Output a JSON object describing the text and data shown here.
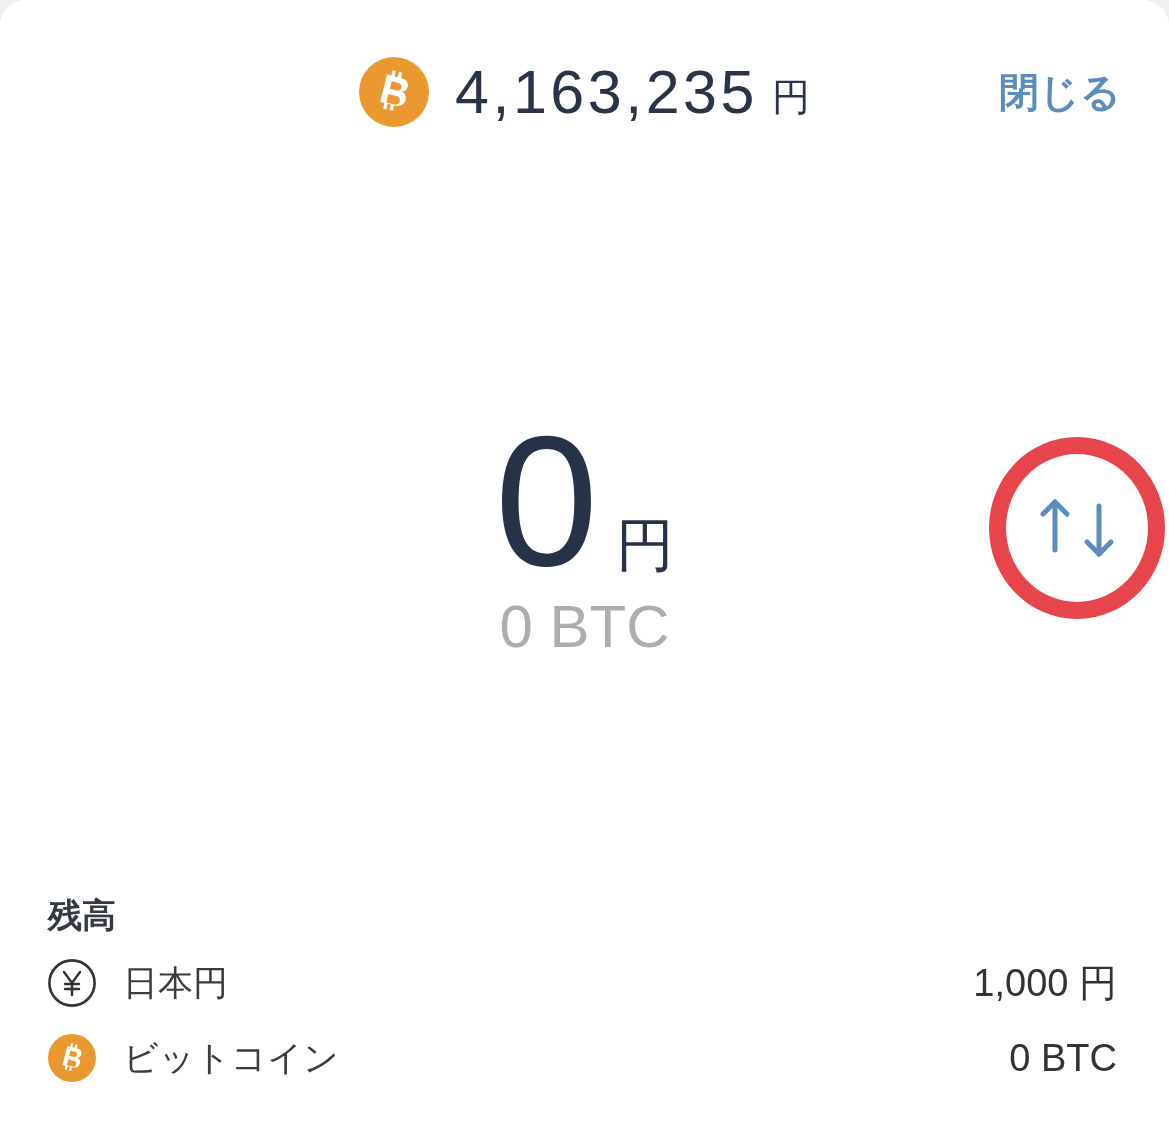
{
  "header": {
    "rate": {
      "amount": "4,163,235",
      "unit": "円"
    },
    "close_button": "閉じる"
  },
  "amount": {
    "value": "0",
    "unit": "円",
    "converted": "0 BTC"
  },
  "swap_button": {
    "highlighted": true
  },
  "balance": {
    "title": "残高",
    "items": [
      {
        "kind": "yen",
        "name": "日本円",
        "amount": "1,000 円"
      },
      {
        "kind": "bitcoin",
        "name": "ビットコイン",
        "amount": "0 BTC"
      }
    ]
  }
}
